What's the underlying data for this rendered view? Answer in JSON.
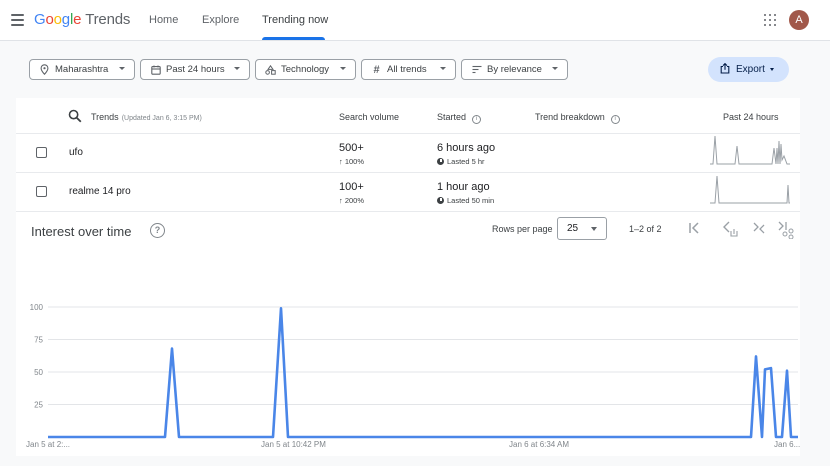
{
  "header": {
    "logo": {
      "g1": "G",
      "o1": "o",
      "o2": "o",
      "g2": "g",
      "l": "l",
      "e": "e",
      "product": "Trends"
    },
    "nav": [
      "Home",
      "Explore",
      "Trending now"
    ],
    "avatar_letter": "A"
  },
  "filters": {
    "location": "Maharashtra",
    "time": "Past 24 hours",
    "category": "Technology",
    "trend_type": "All trends",
    "sort": "By relevance",
    "export": "Export"
  },
  "table": {
    "headers": {
      "trends": "Trends",
      "updated": "(Updated Jan 6, 3:15 PM)",
      "volume": "Search volume",
      "started": "Started",
      "breakdown": "Trend breakdown",
      "past": "Past 24 hours"
    },
    "rows": [
      {
        "term": "ufo",
        "volume": "500+",
        "growth": "↑ 100%",
        "started": "6 hours ago",
        "lasted": "Lasted 5 hr"
      },
      {
        "term": "realme 14 pro",
        "volume": "100+",
        "growth": "↑ 200%",
        "started": "1 hour ago",
        "lasted": "Lasted 50 min"
      }
    ]
  },
  "pagination": {
    "rows_per_page_label": "Rows per page",
    "rows_per_page": "25",
    "range": "1–2 of 2"
  },
  "interest": {
    "title": "Interest over time",
    "help": "?"
  },
  "chart_data": {
    "type": "line",
    "title": "Interest over time",
    "ylim": [
      0,
      100
    ],
    "y_ticks": [
      25,
      50,
      75,
      100
    ],
    "x_ticks": [
      "Jan 5 at 2:...",
      "Jan 5 at 10:42 PM",
      "Jan 6 at 6:34 AM",
      "Jan 6..."
    ],
    "grid": true,
    "series": [
      {
        "color": "#4a86e8",
        "points": [
          [
            0,
            0
          ],
          [
            117,
            0
          ],
          [
            124,
            68
          ],
          [
            131,
            0
          ],
          [
            225,
            0
          ],
          [
            233,
            99
          ],
          [
            240,
            0
          ],
          [
            703,
            0
          ],
          [
            708,
            62
          ],
          [
            714,
            0
          ],
          [
            717,
            52
          ],
          [
            723,
            53
          ],
          [
            728,
            0
          ],
          [
            734,
            0
          ],
          [
            739,
            51
          ],
          [
            743,
            0
          ],
          [
            750,
            0
          ]
        ]
      }
    ]
  },
  "colors": {
    "accent": "#1a73e8",
    "line": "#4a86e8",
    "export_bg": "#d3e3fd"
  }
}
